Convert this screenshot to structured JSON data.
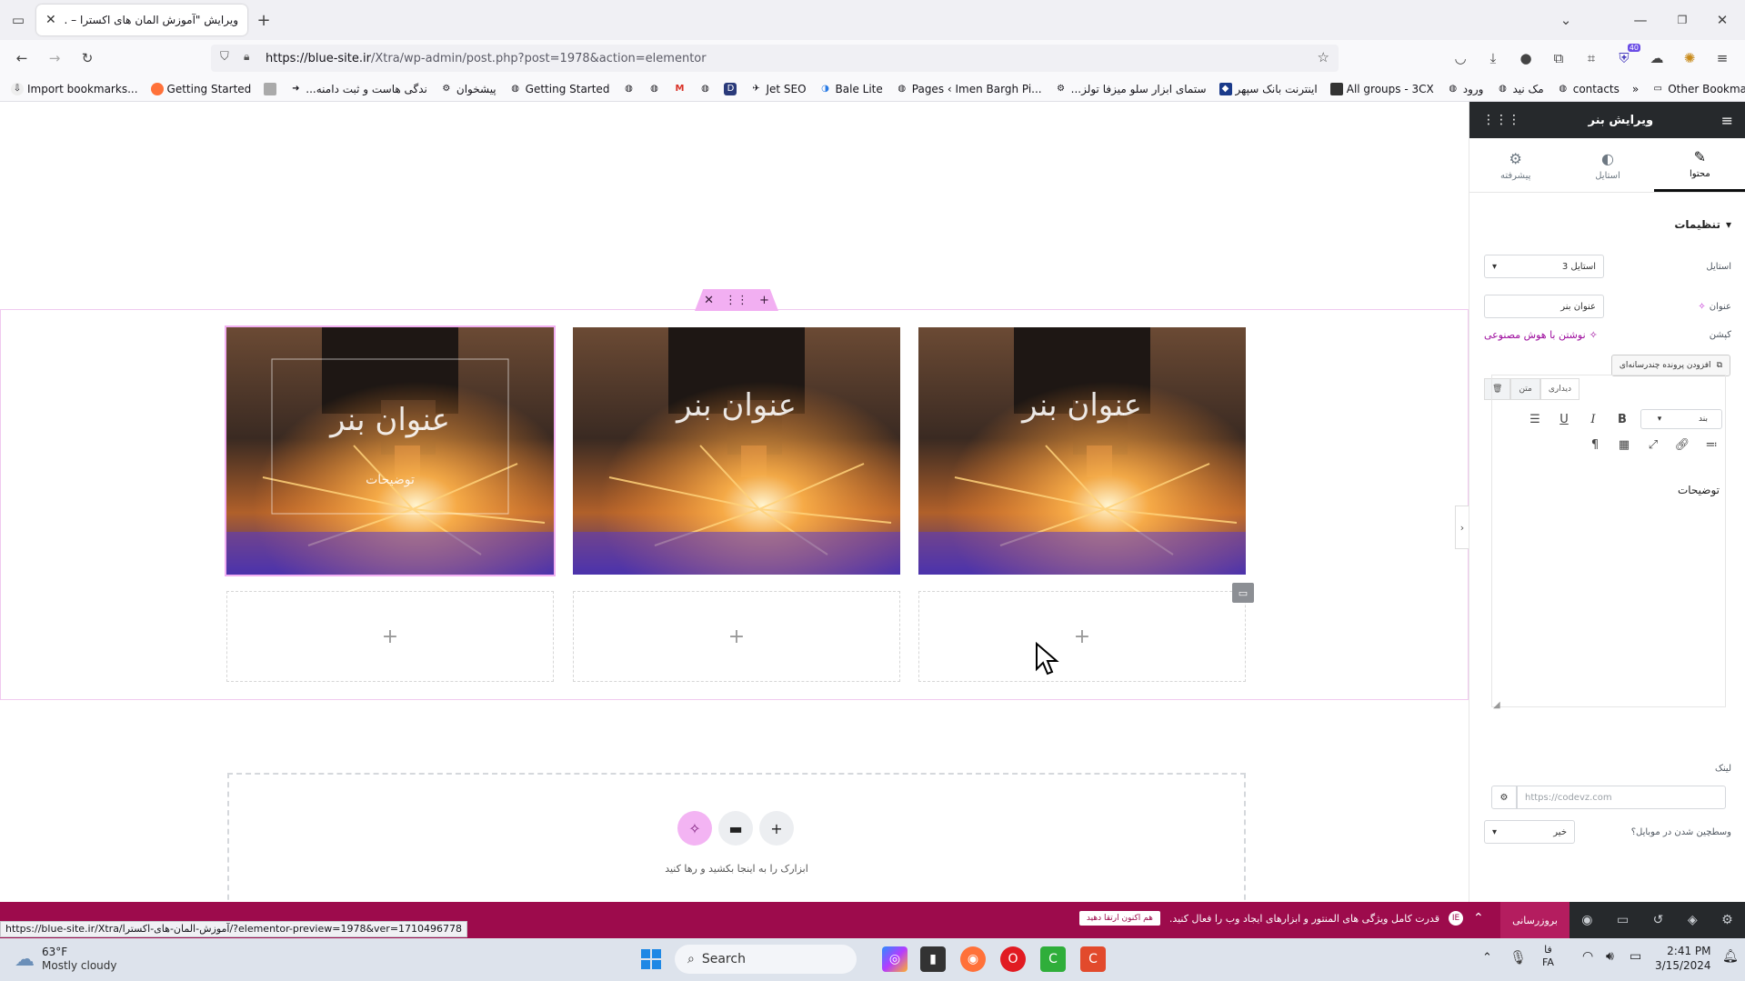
{
  "browser": {
    "tab_title": "ویرایش \"آموزش المان های اکسترا – ...",
    "url_host": "https://blue-site.ir",
    "url_path": "/Xtra/wp-admin/post.php?post=1978&action=elementor",
    "extension_badge": "40",
    "bookmarks": [
      {
        "label": "Import bookmarks...",
        "icon": "import-icon"
      },
      {
        "label": "Getting Started",
        "icon": "firefox-icon"
      },
      {
        "label": "",
        "icon": "calendar-icon"
      },
      {
        "label": "...ندگی هاست و ثبت دامنه",
        "icon": "arrow-icon"
      },
      {
        "label": "پیشخوان",
        "icon": "gear-icon"
      },
      {
        "label": "Getting Started",
        "icon": "globe-icon"
      },
      {
        "label": "",
        "icon": "globe-icon"
      },
      {
        "label": "",
        "icon": "globe-icon"
      },
      {
        "label": "",
        "icon": "gmail-icon"
      },
      {
        "label": "",
        "icon": "globe-icon"
      },
      {
        "label": "",
        "icon": "d-icon"
      },
      {
        "label": "Jet SEO",
        "icon": "rocket-icon"
      },
      {
        "label": "Bale Lite",
        "icon": "bale-icon"
      },
      {
        "label": "Pages ‹ Imen Bargh Pi...",
        "icon": "globe-icon"
      },
      {
        "label": "...ستمای ابزار سلو میزفا تولز",
        "icon": "gear-icon"
      },
      {
        "label": "اینترنت بانک سپهر",
        "icon": "bank-icon"
      },
      {
        "label": "All groups - 3CX",
        "icon": "3cx-icon"
      },
      {
        "label": "ورود",
        "icon": "globe-icon"
      },
      {
        "label": "مک نید",
        "icon": "globe-icon"
      },
      {
        "label": "contacts",
        "icon": "globe-icon"
      }
    ],
    "other_bookmarks": "Other Bookmarks",
    "status_url": "https://blue-site.ir/Xtra/آموزش-المان-های-اکسترا/?elementor-preview=1978&ver=1710496778"
  },
  "canvas": {
    "banners": [
      {
        "title": "عنوان بنر",
        "subtitle": "توضیحات"
      },
      {
        "title": "عنوان بنر"
      },
      {
        "title": "عنوان بنر"
      }
    ],
    "add_symbol": "+",
    "dropzone_text": "ابزارک را به اینجا بکشید و رها کنید"
  },
  "panel": {
    "title": "ویرایش بنر",
    "tabs": [
      {
        "label": "محتوا",
        "icon": "pencil-icon"
      },
      {
        "label": "استایل",
        "icon": "contrast-icon"
      },
      {
        "label": "پیشرفته",
        "icon": "gear-icon"
      }
    ],
    "section_title": "تنظیمات",
    "style_label": "استایل",
    "style_value": "استایل 3",
    "heading_label": "عنوان",
    "heading_value": "عنوان بنر",
    "caption_label": "کپشن",
    "ai_link": "نوشتن با هوش مصنوعی",
    "add_media": "افزودن پرونده چندرسانه‌ای",
    "editor_tab_visual": "دیداری",
    "editor_tab_text": "متن",
    "format_value": "بند",
    "editor_content": "توضیحات",
    "link_label": "لینک",
    "link_placeholder": "https://codevz.com",
    "mobile_label": "وسطچین شدن در موبایل؟",
    "mobile_value": "خیر"
  },
  "elementor_bar": {
    "promo_text": "قدرت کامل ویژگی های المنتور و ابزارهای ایجاد وب را فعال کنید.",
    "promo_cta": "هم اکنون ارتقا دهید",
    "upgrade": "بروزرسانی"
  },
  "taskbar": {
    "weather_temp": "63°F",
    "weather_desc": "Mostly cloudy",
    "search_placeholder": "Search",
    "lang_top": "فا",
    "lang_bottom": "FA",
    "time": "2:41 PM",
    "date": "3/15/2024"
  }
}
